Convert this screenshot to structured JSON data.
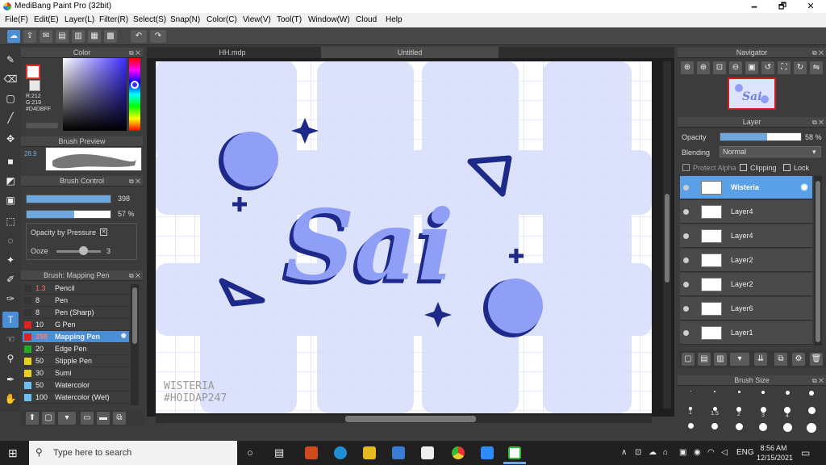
{
  "window": {
    "title": "MediBang Paint Pro (32bit)",
    "minimize": "🗕",
    "restore": "🗗",
    "close": "✕"
  },
  "menu": [
    "File(F)",
    "Edit(E)",
    "Layer(L)",
    "Filter(R)",
    "Select(S)",
    "Snap(N)",
    "Color(C)",
    "View(V)",
    "Tool(T)",
    "Window(W)",
    "Cloud",
    "Help"
  ],
  "toolbar": {
    "icons": [
      "cloud-icon",
      "export-icon",
      "chat-icon",
      "comment-icon",
      "page-icon",
      "grid-icon",
      "panel-icon",
      "undo-icon",
      "redo-icon"
    ]
  },
  "tabs": [
    "HH.mdp",
    "Untitled"
  ],
  "color_panel": {
    "title": "Color",
    "r": "R:212",
    "g": "G:219",
    "hex": "#D4DBFF"
  },
  "brush_preview": {
    "title": "Brush Preview",
    "size": "28.9"
  },
  "brush_control": {
    "title": "Brush Control",
    "size_value": "398",
    "size_fill": 1.0,
    "opacity_value": "57 %",
    "opacity_fill": 0.57,
    "opacity_pressure": "Opacity by Pressure",
    "ooze_label": "Ooze",
    "ooze_value": "3",
    "ooze_fill": 0.4
  },
  "brush_list": {
    "title": "Brush: Mapping Pen",
    "items": [
      {
        "size": "1.3",
        "name": "Pencil",
        "color": "#333333"
      },
      {
        "size": "8",
        "name": "Pen",
        "color": "#333333"
      },
      {
        "size": "8",
        "name": "Pen (Sharp)",
        "color": "#333333"
      },
      {
        "size": "10",
        "name": "G Pen",
        "color": "#e02020"
      },
      {
        "size": "398",
        "name": "Mapping Pen",
        "color": "#e02020"
      },
      {
        "size": "20",
        "name": "Edge Pen",
        "color": "#22aa22"
      },
      {
        "size": "50",
        "name": "Stipple Pen",
        "color": "#e8d020"
      },
      {
        "size": "30",
        "name": "Sumi",
        "color": "#e8d020"
      },
      {
        "size": "50",
        "name": "Watercolor",
        "color": "#6ec0f0"
      },
      {
        "size": "100",
        "name": "Watercolor (Wet)",
        "color": "#6ec0f0"
      }
    ]
  },
  "canvas": {
    "text_main": "Sai",
    "watermark_line1": "WISTERIA",
    "watermark_line2": "#HOIDAP247",
    "accent": "#8e9ff5"
  },
  "navigator": {
    "title": "Navigator"
  },
  "layer_panel": {
    "title": "Layer",
    "opacity_label": "Opacity",
    "opacity_value": "58 %",
    "opacity_fill": 0.58,
    "blending_label": "Blending",
    "blending_value": "Normal",
    "protect_alpha": "Protect Alpha",
    "clipping": "Clipping",
    "lock": "Lock",
    "layers": [
      "Wisteria",
      "Layer4",
      "Layer4",
      "Layer2",
      "Layer2",
      "Layer6",
      "Layer1"
    ]
  },
  "brush_size": {
    "title": "Brush Size",
    "sizes": [
      "1",
      "1.5",
      "2",
      "3",
      "4"
    ]
  },
  "taskbar": {
    "search_placeholder": "Type here to search",
    "time": "8:56 AM",
    "date": "12/15/2021",
    "lang": "ENG"
  }
}
